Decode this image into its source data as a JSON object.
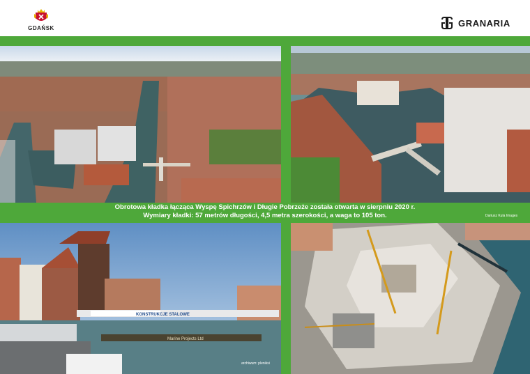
{
  "header": {
    "left_logo_text": "GDAŃSK",
    "right_logo_text": "GRANARIA"
  },
  "caption": {
    "line1": "Obrotowa kładka łącząca Wyspę Spichrzów i Długie Pobrzeże została otwarta w sierpniu 2020 r.",
    "line2": "Wymiary kładki: 57 metrów długości, 4,5 metra szerokości, a waga to 105 ton."
  },
  "credits": {
    "top_right": "Dariusz Kula Images",
    "bottom_left": "archiwum: pleniksi"
  },
  "photo3": {
    "bridge_banner": "KONSTRUKCJE STALOWE",
    "barge_text": "Marine Projects Ltd"
  },
  "colors": {
    "brand_green": "#4ea83a",
    "background": "#ffffff"
  }
}
